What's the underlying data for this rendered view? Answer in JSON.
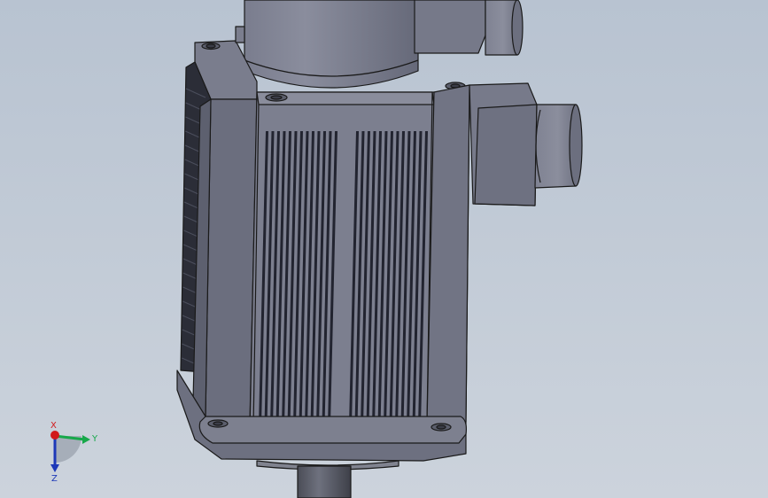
{
  "viewport": {
    "background_top": "#b8c3d1",
    "background_bottom": "#ccd3dc"
  },
  "model": {
    "body_color": "#6f7181",
    "edge_color": "#1a1a1a",
    "vent_slot_color": "#222430"
  },
  "triad": {
    "x_label": "X",
    "y_label": "Y",
    "z_label": "Z",
    "x_color": "#d11a1a",
    "y_color": "#17a84a",
    "z_color": "#1d38b8"
  }
}
